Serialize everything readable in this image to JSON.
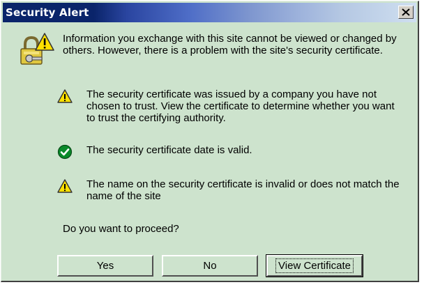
{
  "window": {
    "title": "Security Alert"
  },
  "icons": {
    "title_close": "close-icon",
    "main": "lock-key-warning-icon",
    "warning": "warning-icon",
    "ok": "check-icon"
  },
  "colors": {
    "dialog_background": "#cde3cd",
    "titlebar_start": "#0a246a",
    "titlebar_end": "#cfdff0",
    "warning_yellow": "#ffe000",
    "ok_green": "#0a8a2a"
  },
  "dialog": {
    "intro": "Information you exchange with this site cannot be viewed or changed by others. However, there is a problem with the site's security certificate.",
    "items": [
      {
        "status": "warning",
        "text": "The security certificate was issued by a company you have not chosen to trust. View the certificate to determine whether you want to trust the certifying authority."
      },
      {
        "status": "ok",
        "text": "The security certificate date is valid."
      },
      {
        "status": "warning",
        "text": "The name on the security certificate is invalid or does not match the name of the site"
      }
    ],
    "question": "Do you want to proceed?"
  },
  "buttons": {
    "yes": "Yes",
    "no": "No",
    "view_certificate": "View Certificate"
  }
}
